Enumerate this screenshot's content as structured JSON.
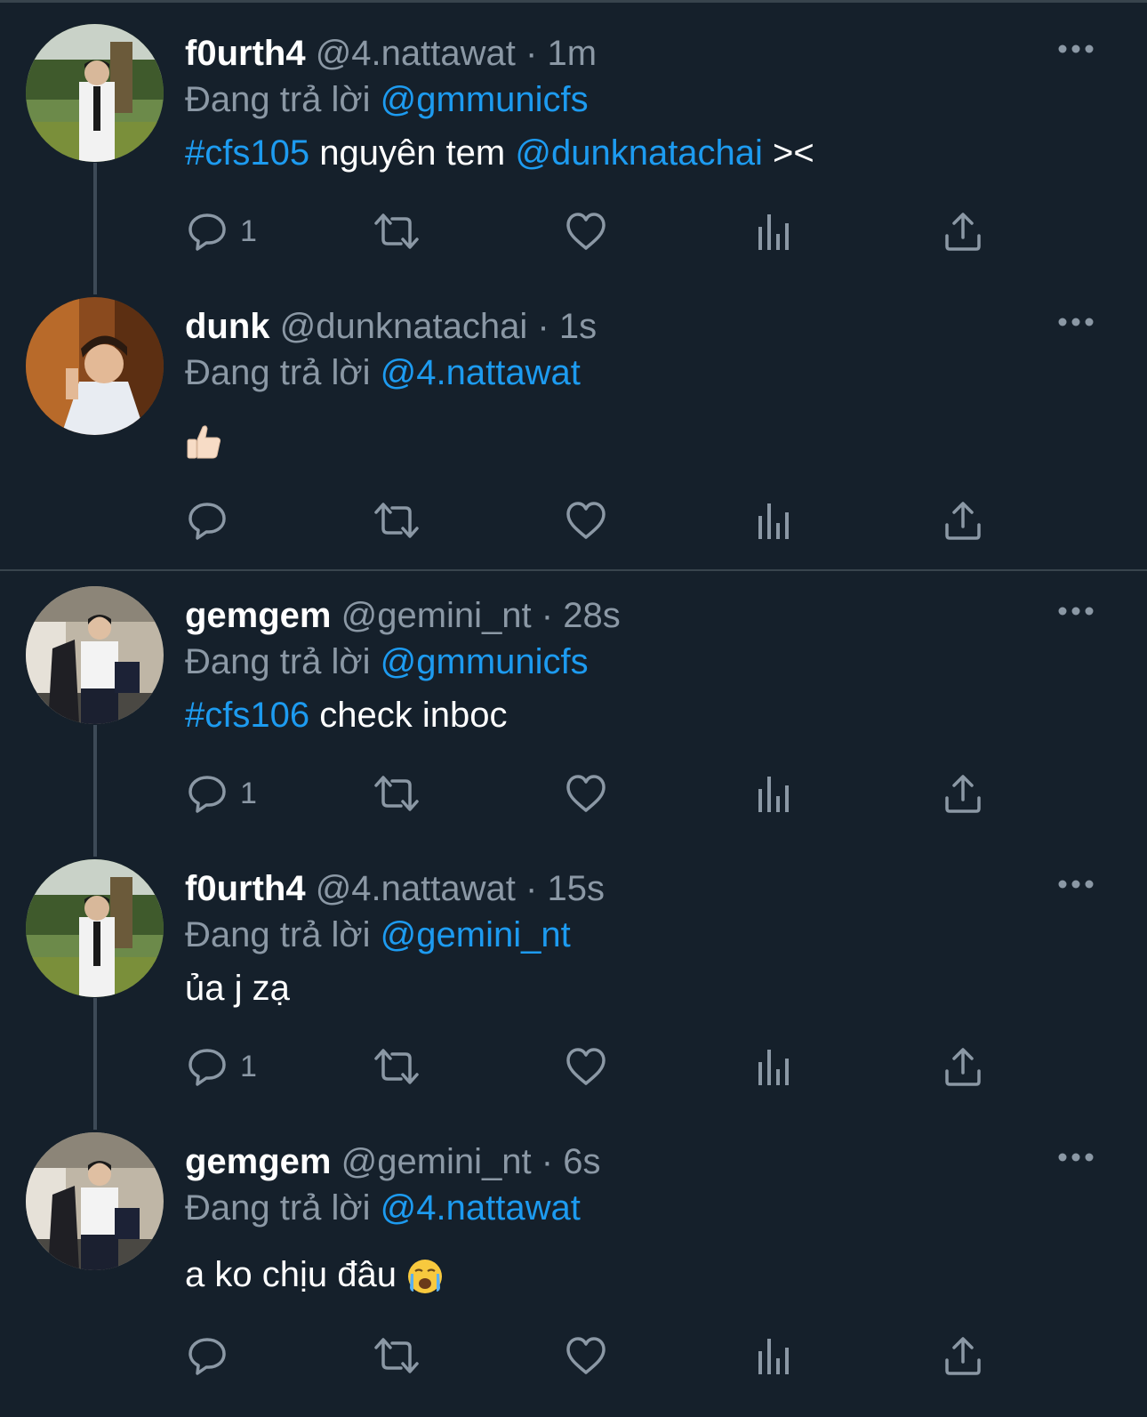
{
  "reply_prefix": "Đang trả lời",
  "tweets": [
    {
      "name": "f0urth4",
      "handle": "@4.nattawat",
      "sep": "·",
      "time": "1m",
      "reply_to": "@gmmunicfs",
      "text_parts": [
        {
          "t": "#cfs105",
          "c": "hashtag"
        },
        {
          "t": " nguyên tem ",
          "c": "plain"
        },
        {
          "t": "@dunknatachai",
          "c": "hashtag"
        },
        {
          "t": " ><",
          "c": "plain"
        }
      ],
      "reply_count": "1",
      "avatar": "man-white-shirt-garden"
    },
    {
      "name": "dunk",
      "handle": "@dunknatachai",
      "sep": "·",
      "time": "1s",
      "reply_to": "@4.nattawat",
      "text_parts": [],
      "emoji": "thumbs-up-emoji",
      "reply_count": "",
      "avatar": "man-warm-room"
    },
    {
      "name": "gemgem",
      "handle": "@gemini_nt",
      "sep": "·",
      "time": "28s",
      "reply_to": "@gmmunicfs",
      "text_parts": [
        {
          "t": "#cfs106",
          "c": "hashtag"
        },
        {
          "t": " check inboc",
          "c": "plain"
        }
      ],
      "reply_count": "1",
      "avatar": "man-jacket-corridor"
    },
    {
      "name": "f0urth4",
      "handle": "@4.nattawat",
      "sep": "·",
      "time": "15s",
      "reply_to": "@gemini_nt",
      "text_parts": [
        {
          "t": "ủa j zạ",
          "c": "plain"
        }
      ],
      "reply_count": "1",
      "avatar": "man-white-shirt-garden"
    },
    {
      "name": "gemgem",
      "handle": "@gemini_nt",
      "sep": "·",
      "time": "6s",
      "reply_to": "@4.nattawat",
      "text_parts": [
        {
          "t": "a ko chịu đâu ",
          "c": "plain"
        }
      ],
      "emoji": "crying-face-emoji",
      "reply_count": "",
      "avatar": "man-jacket-corridor"
    }
  ],
  "colors": {
    "background": "#15202b",
    "accent": "#1d9bf0",
    "muted": "#8b98a5"
  }
}
